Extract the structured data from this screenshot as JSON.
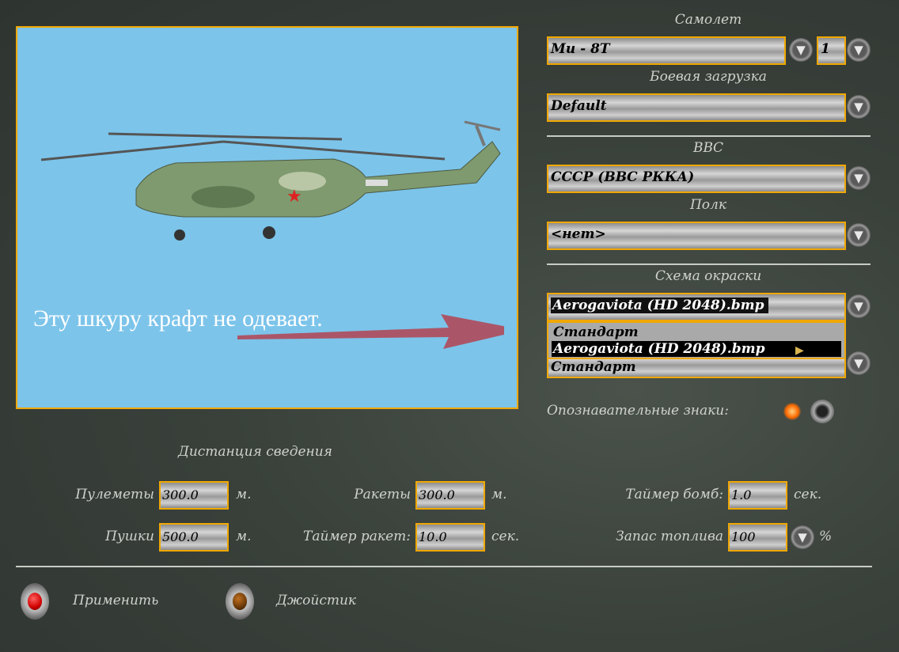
{
  "preview": {
    "annotation": "Эту шкуру крафт не одевает.",
    "background": "#7cc4ea"
  },
  "aircraft": {
    "label": "Самолет",
    "value": "Mu - 8T",
    "count": "1"
  },
  "loadout": {
    "label": "Боевая загрузка",
    "value": "Default"
  },
  "airforce": {
    "label": "ВВС",
    "value": "СССР (ВВС РККА)"
  },
  "regiment": {
    "label": "Полк",
    "value": "<нет>"
  },
  "skin": {
    "label": "Схема окраски",
    "value": "Aerogaviota (HD 2048).bmp",
    "options": [
      "Стандарт",
      "Aerogaviota (HD 2048).bmp"
    ],
    "hidden_combo_value": "Стандарт"
  },
  "markings": {
    "label": "Опознавательные знаки:",
    "enabled": true
  },
  "convergence": {
    "title": "Дистанция сведения",
    "machineguns": {
      "label": "Пулеметы",
      "value": "300.0",
      "unit": "м."
    },
    "cannons": {
      "label": "Пушки",
      "value": "500.0",
      "unit": "м."
    },
    "rockets": {
      "label": "Ракеты",
      "value": "300.0",
      "unit": "м."
    },
    "rocket_timer": {
      "label": "Таймер ракет:",
      "value": "10.0",
      "unit": "сек."
    },
    "bomb_timer": {
      "label": "Таймер бомб:",
      "value": "1.0",
      "unit": "сек."
    },
    "fuel": {
      "label": "Запас топлива",
      "value": "100",
      "unit": "%"
    }
  },
  "buttons": {
    "apply": "Применить",
    "joystick": "Джойстик"
  },
  "colors": {
    "accent": "#f0a800",
    "text": "#cfd2cd"
  }
}
